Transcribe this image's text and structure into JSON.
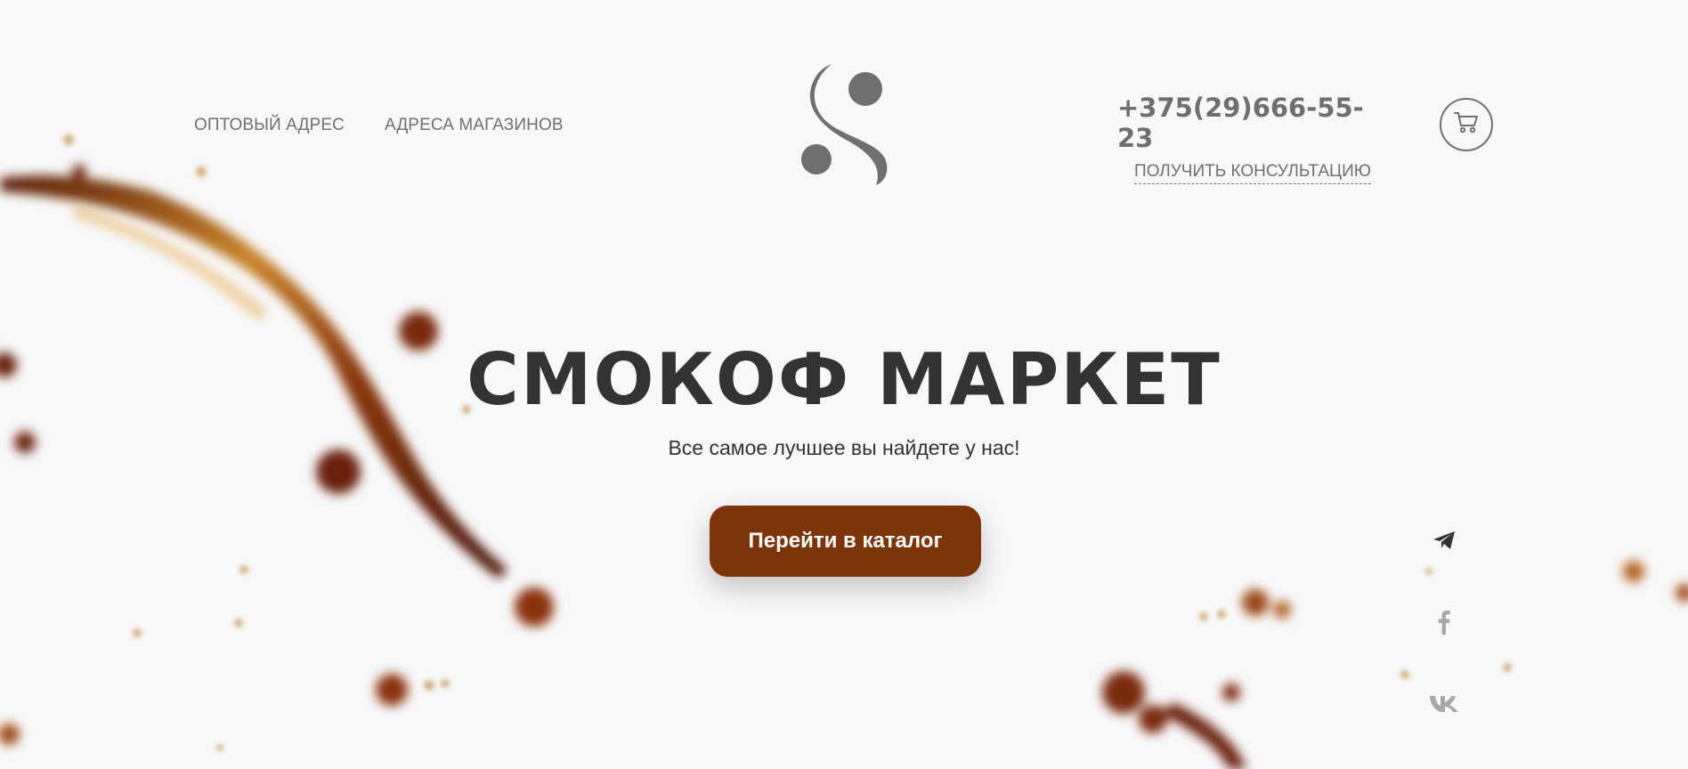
{
  "nav": {
    "items": [
      {
        "label": "ОПТОВЫЙ АДРЕС"
      },
      {
        "label": "АДРЕСА МАГАЗИНОВ"
      }
    ]
  },
  "contact": {
    "phone": "+375(29)666-55-23",
    "consult_label": "ПОЛУЧИТЬ КОНСУЛЬТАЦИЮ"
  },
  "hero": {
    "title": "СМОКОФ МАРКЕТ",
    "subtitle": "Все самое лучшее вы найдете у нас!",
    "cta_label": "Перейти в каталог"
  },
  "icons": {
    "logo": "s-logo-icon",
    "cart": "cart-icon",
    "social": [
      "telegram-icon",
      "facebook-icon",
      "vk-icon"
    ]
  },
  "colors": {
    "background": "#f8f8f8",
    "accent": "#7d3408",
    "text_dark": "#333333",
    "text_muted": "#707070"
  }
}
